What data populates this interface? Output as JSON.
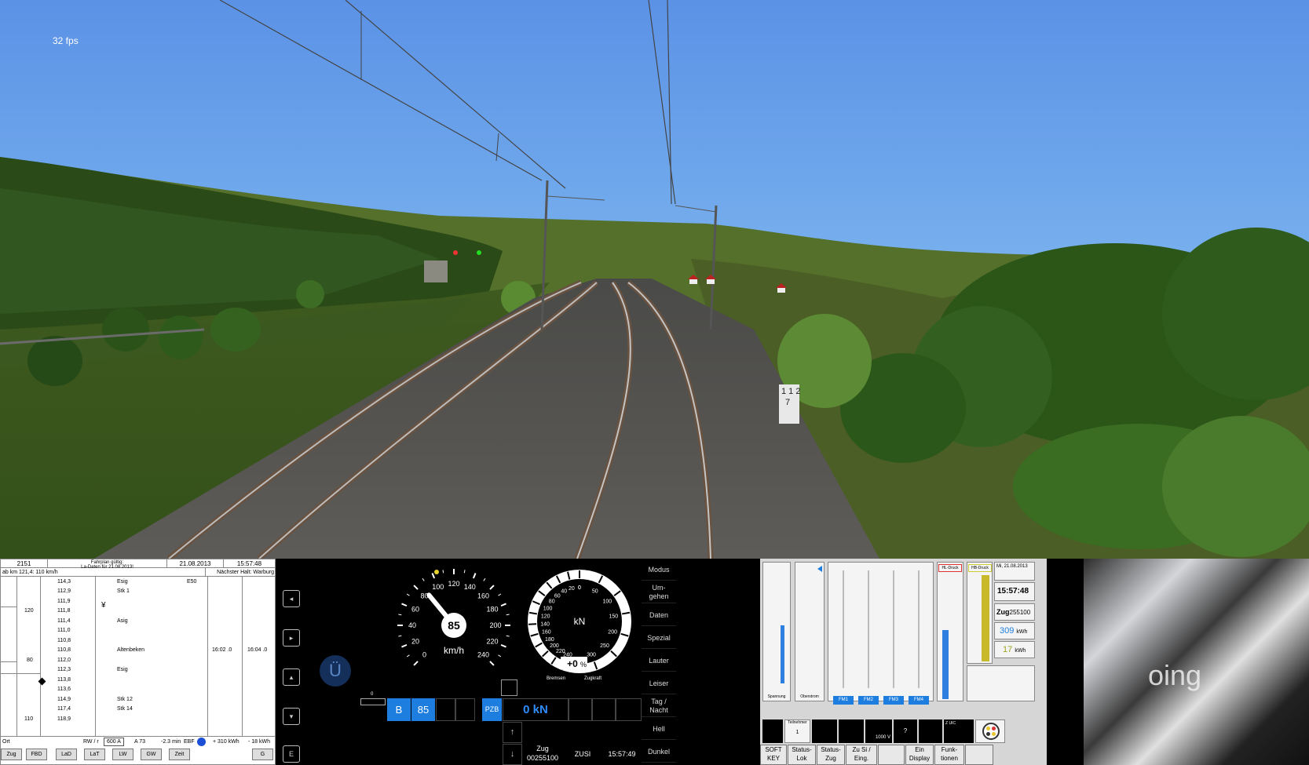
{
  "scene": {
    "fps": "32 fps",
    "km_post_top": "1 1 2",
    "km_post_bottom": "7"
  },
  "timetable": {
    "train": "2151",
    "title_top": "Fahrplan gültig:",
    "title_bottom": "La-Daten für 21.08.2013!",
    "date": "21.08.2013",
    "time": "15:57:48",
    "left_note": "ab km 121,4: 110 km/h",
    "next_stop": "Nächster Halt: Warburg",
    "km": [
      "114,3",
      "112,9",
      "111,9",
      "111,8",
      "111,4",
      "111,0",
      "110,8",
      "110,8",
      "112,0",
      "112,3",
      "113,8",
      "113,6",
      "114,9",
      "117,4",
      "118,9"
    ],
    "stations": [
      {
        "name": "Esig",
        "extra": "E50"
      },
      {
        "name": "Stk 1",
        "extra": ""
      },
      {
        "name": "Asig",
        "extra": ""
      },
      {
        "name": "Altenbeken",
        "extra": ""
      },
      {
        "name": "Esig",
        "extra": ""
      },
      {
        "name": "Stk 12",
        "extra": ""
      },
      {
        "name": "Stk 14",
        "extra": ""
      }
    ],
    "speeds": [
      "120",
      "80",
      "110"
    ],
    "arrival": "16:02 .0",
    "departure": "16:04 .0",
    "foot": {
      "ort": "Ort",
      "rw": "RW / r",
      "rw_val": "600 A",
      "a_val": "A 73",
      "minutes": "-2.3 min",
      "ebf": "EBF",
      "energy1": "+ 310 kWh",
      "energy2": "- 18 kWh"
    },
    "buttons": [
      "Zug",
      "FBD",
      "LaD",
      "LaT",
      "LW",
      "GW",
      "Zeit",
      "G"
    ]
  },
  "cab": {
    "speed": "85",
    "speed_unit": "km/h",
    "speed_ticks": [
      "0",
      "20",
      "40",
      "60",
      "80",
      "100",
      "120",
      "140",
      "160",
      "180",
      "200",
      "220",
      "240"
    ],
    "force_unit": "kN",
    "force_ticks_left": [
      "0",
      "20",
      "40",
      "60",
      "80",
      "100",
      "120",
      "140",
      "160",
      "180",
      "200",
      "220",
      "240"
    ],
    "force_ticks_right": [
      "0",
      "50",
      "100",
      "150",
      "200",
      "250",
      "300"
    ],
    "force_percent": "+0",
    "force_pct_sign": "%",
    "brake_label": "Bremsen",
    "traction_label": "Zugkraft",
    "u_symbol": "Ü",
    "status_b": "B",
    "status_speed": "85",
    "pzb": "PZB",
    "kn_value": "0 kN",
    "bar_zero": "0",
    "zug_label": "Zug",
    "zug_number": "00255100",
    "zusi": "ZUSI",
    "clock": "15:57:49",
    "menu": [
      "Modus",
      "Um-\ngehen",
      "Daten",
      "Spezial",
      "Lauter",
      "Leiser",
      "Tag /\nNacht",
      "Hell",
      "Dunkel"
    ]
  },
  "energy": {
    "spannung": "Spannung",
    "oberstrom": "Oberstrom",
    "fm": [
      "FM1",
      "FM2",
      "FM3",
      "FM4"
    ],
    "hl": "HL-Druck",
    "hb": "HB-Druck",
    "date": "Mi, 21.08.2013",
    "time": "15:57:48",
    "zug_label": "Zug",
    "zug": "255100",
    "kwh1": "309",
    "kwh2": "17",
    "kwh_unit": "kWh",
    "teilnehmer": "Teilnehmer",
    "teilnehmer_val": "1",
    "voltage": "1000 V",
    "question": "?",
    "uic": "Z UIC",
    "softkeys": [
      "SOFT KEY",
      "Status-Lok",
      "Status-Zug",
      "Zu Si / Eing.",
      "",
      "Ein Display",
      "Funk-tionen"
    ]
  },
  "video": {
    "text": "oing"
  }
}
